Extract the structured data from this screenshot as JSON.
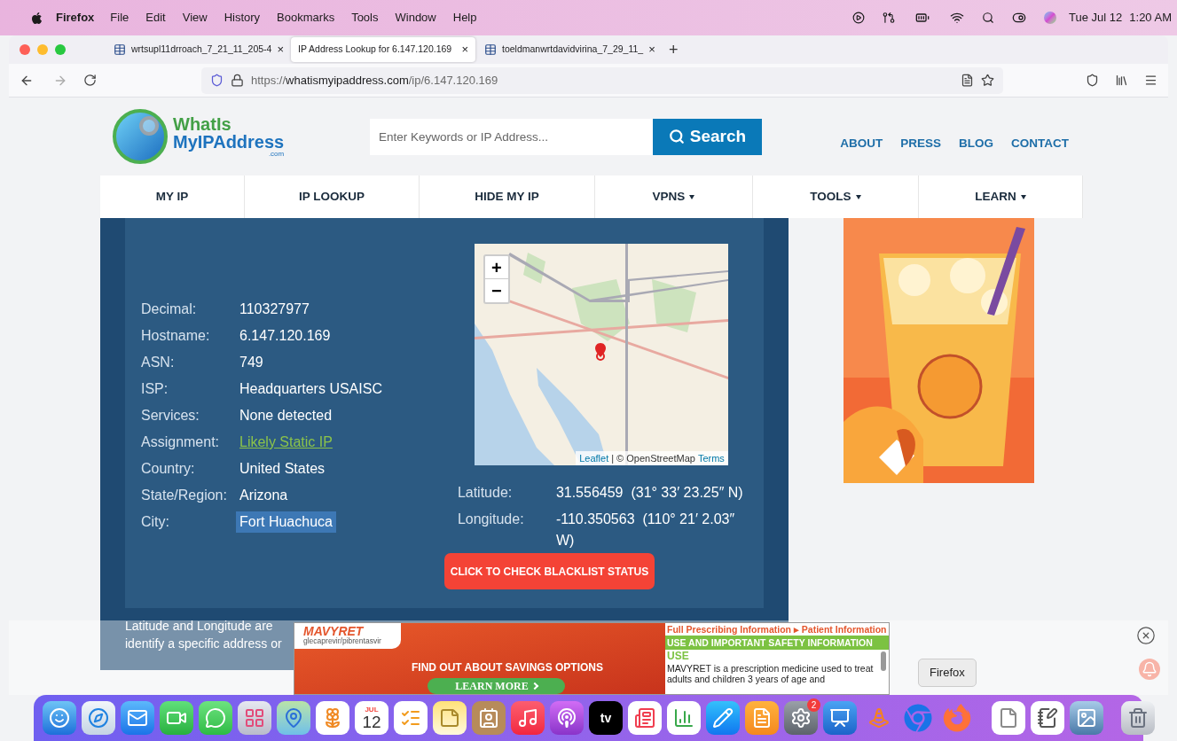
{
  "menu_bar": {
    "app": "Firefox",
    "items": [
      "File",
      "Edit",
      "View",
      "History",
      "Bookmarks",
      "Tools",
      "Window",
      "Help"
    ],
    "date": "Tue Jul 12",
    "time": "1:20 AM"
  },
  "tabs": [
    {
      "label": "wrtsupl11drroach_7_21_11_205-4",
      "close": "×",
      "selected": false,
      "kind": "file"
    },
    {
      "label": "IP Address Lookup for 6.147.120.169",
      "close": "×",
      "selected": true,
      "kind": "page"
    },
    {
      "label": "toeldmanwrtdavidvirina_7_29_11_",
      "close": "×",
      "selected": false,
      "kind": "file"
    }
  ],
  "new_tab": "+",
  "url": {
    "scheme": "https://",
    "domain": "whatismyipaddress.com",
    "path": "/ip/6.147.120.169"
  },
  "site": {
    "logo": {
      "line1": "WhatIs",
      "line2": "MyIPAddress",
      "suffix": ".com"
    },
    "search": {
      "placeholder": "Enter Keywords or IP Address...",
      "button": "Search"
    },
    "top_links": [
      "ABOUT",
      "PRESS",
      "BLOG",
      "CONTACT"
    ],
    "nav": [
      {
        "label": "MY IP",
        "dropdown": false
      },
      {
        "label": "IP LOOKUP",
        "dropdown": false
      },
      {
        "label": "HIDE MY IP",
        "dropdown": false
      },
      {
        "label": "VPNS",
        "dropdown": true
      },
      {
        "label": "TOOLS",
        "dropdown": true
      },
      {
        "label": "LEARN",
        "dropdown": true
      }
    ]
  },
  "details": [
    {
      "label": "Decimal:",
      "value": "110327977",
      "kind": "text",
      "highlighted": false
    },
    {
      "label": "Hostname:",
      "value": "6.147.120.169",
      "kind": "text",
      "highlighted": false
    },
    {
      "label": "ASN:",
      "value": "749",
      "kind": "text",
      "highlighted": false
    },
    {
      "label": "ISP:",
      "value": "Headquarters USAISC",
      "kind": "text",
      "highlighted": false
    },
    {
      "label": "Services:",
      "value": "None detected",
      "kind": "text",
      "highlighted": false
    },
    {
      "label": "Assignment:",
      "value": "Likely Static IP",
      "kind": "link",
      "highlighted": false
    },
    {
      "label": "Country:",
      "value": "United States",
      "kind": "text",
      "highlighted": false
    },
    {
      "label": "State/Region:",
      "value": "Arizona",
      "kind": "text",
      "highlighted": false
    },
    {
      "label": "City:",
      "value": "Fort Huachuca",
      "kind": "text",
      "highlighted": true
    }
  ],
  "map": {
    "zoom_in": "+",
    "zoom_out": "−",
    "attribution": {
      "leaflet": "Leaflet",
      "separator": "|",
      "osm": "© OpenStreetMap",
      "terms": "Terms"
    }
  },
  "coordinates": [
    {
      "label": "Latitude:",
      "value": "31.556459  (31° 33′ 23.25″ N)"
    },
    {
      "label": "Longitude:",
      "value": "-110.350563  (110° 21′ 2.03″ W)"
    }
  ],
  "blacklist_button": "CLICK TO CHECK BLACKLIST STATUS",
  "footnote": [
    "Latitude and Longitude are",
    "identify a specific address or"
  ],
  "ad": {
    "brand": "MAVYRET",
    "generic": "glecaprevir/pibrentasvir",
    "headline": "FIND OUT ABOUT SAVINGS OPTIONS",
    "cta": "LEARN MORE",
    "links": "Full Prescribing Information ▸ Patient Information",
    "banner": "USE AND IMPORTANT SAFETY INFORMATION",
    "heading": "USE",
    "body": "MAVYRET is a prescription medicine used to treat adults and children 3 years of age and"
  },
  "tooltip": "Firefox",
  "dock": {
    "calendar_month": "JUL",
    "calendar_day": "12",
    "tv_label": "tv",
    "settings_badge": "2"
  }
}
